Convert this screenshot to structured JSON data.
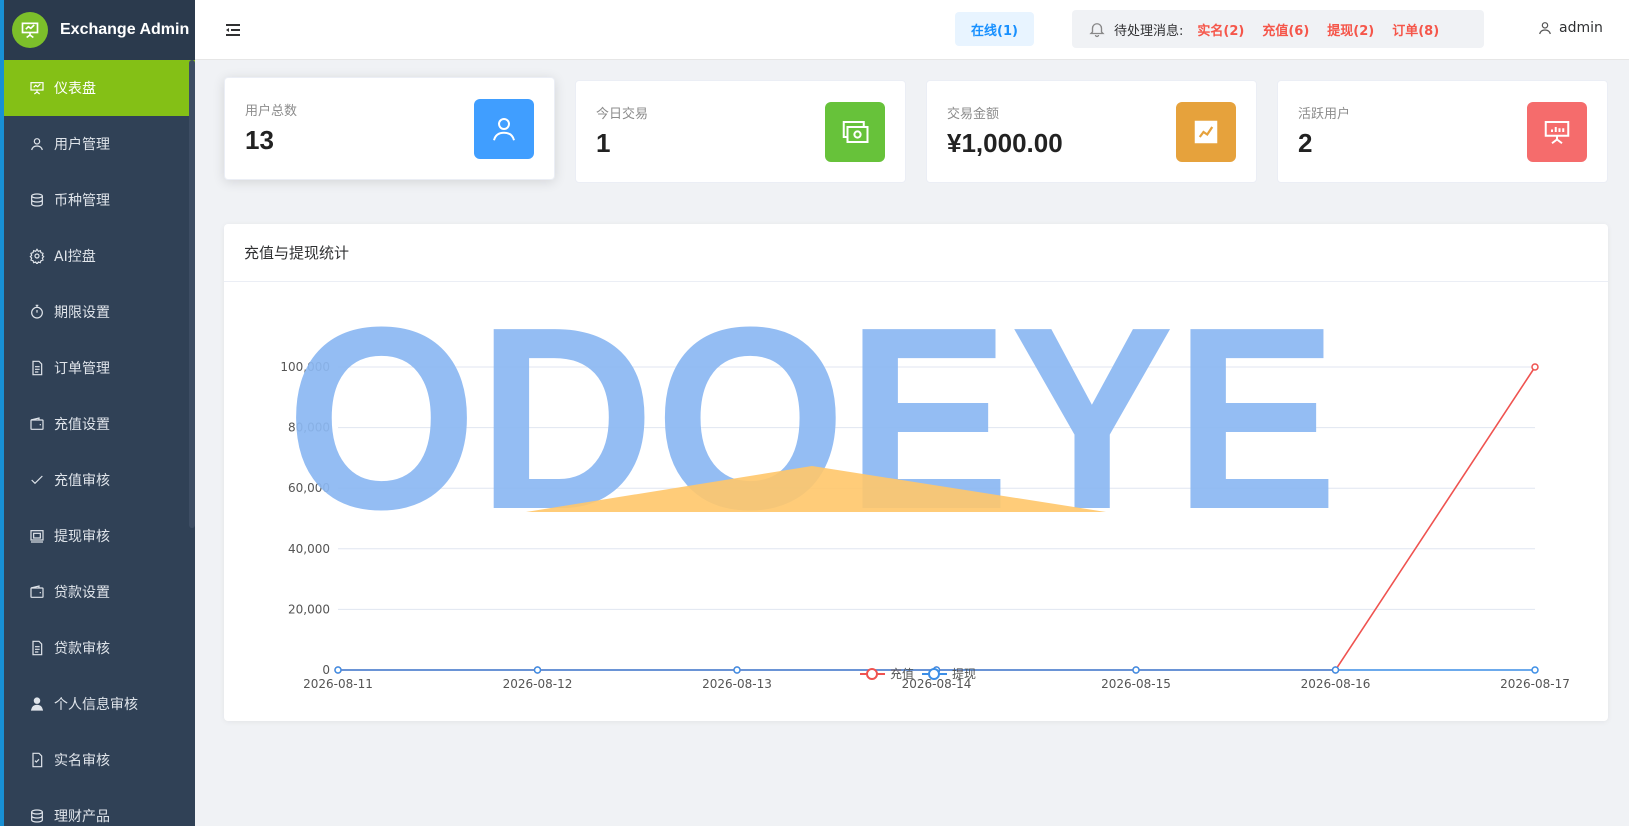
{
  "app": {
    "title": "Exchange Admin"
  },
  "sidebar": {
    "items": [
      {
        "label": "仪表盘",
        "icon": "dashboard-icon",
        "active": true
      },
      {
        "label": "用户管理",
        "icon": "user-icon"
      },
      {
        "label": "币种管理",
        "icon": "coin-icon"
      },
      {
        "label": "AI控盘",
        "icon": "gear-icon"
      },
      {
        "label": "期限设置",
        "icon": "stopwatch-icon"
      },
      {
        "label": "订单管理",
        "icon": "document-icon"
      },
      {
        "label": "充值设置",
        "icon": "wallet-icon"
      },
      {
        "label": "充值审核",
        "icon": "check-icon"
      },
      {
        "label": "提现审核",
        "icon": "money-icon"
      },
      {
        "label": "贷款设置",
        "icon": "wallet-icon"
      },
      {
        "label": "贷款审核",
        "icon": "document-icon"
      },
      {
        "label": "个人信息审核",
        "icon": "person-icon"
      },
      {
        "label": "实名审核",
        "icon": "id-check-icon"
      },
      {
        "label": "理财产品",
        "icon": "coin-icon"
      }
    ]
  },
  "header": {
    "online": "在线(1)",
    "pending_label": "待处理消息:",
    "pending_items": [
      {
        "label": "实名(2)"
      },
      {
        "label": "充值(6)"
      },
      {
        "label": "提现(2)"
      },
      {
        "label": "订单(8)"
      }
    ],
    "user": "admin"
  },
  "stats": [
    {
      "label": "用户总数",
      "value": "13",
      "color": "#409eff",
      "icon": "user-icon"
    },
    {
      "label": "今日交易",
      "value": "1",
      "color": "#67c23a",
      "icon": "money-icon"
    },
    {
      "label": "交易金额",
      "value": "¥1,000.00",
      "color": "#e6a23c",
      "icon": "chart-trend-icon"
    },
    {
      "label": "活跃用户",
      "value": "2",
      "color": "#f56c6c",
      "icon": "presentation-icon"
    }
  ],
  "panel": {
    "title": "充值与提现统计"
  },
  "watermark": {
    "text": "ODOEYE",
    "color": "#8cb8f2",
    "accent": "#ffc76a"
  },
  "chart_data": {
    "type": "line",
    "x": [
      "2026-08-11",
      "2026-08-12",
      "2026-08-13",
      "2026-08-14",
      "2026-08-15",
      "2026-08-16",
      "2026-08-17"
    ],
    "ylim": [
      0,
      100000
    ],
    "yticks": [
      "0",
      "20,000",
      "40,000",
      "60,000",
      "80,000",
      "100,000"
    ],
    "grid": true,
    "legend_position": "bottom-center",
    "series": [
      {
        "name": "充值",
        "color": "#ef5350",
        "values": [
          0,
          0,
          0,
          0,
          0,
          0,
          100000
        ]
      },
      {
        "name": "提现",
        "color": "#3c8ee6",
        "values": [
          0,
          0,
          0,
          0,
          0,
          0,
          0
        ]
      }
    ]
  }
}
